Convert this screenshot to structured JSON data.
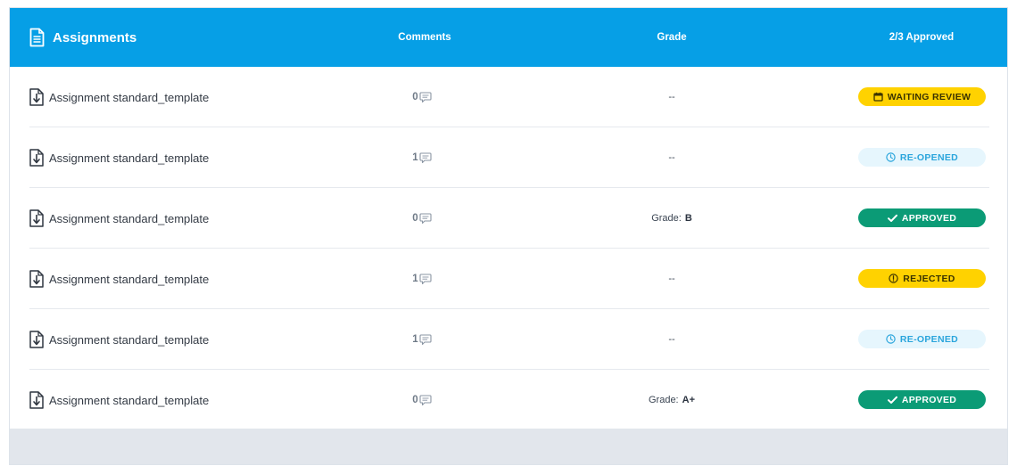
{
  "header": {
    "title": "Assignments",
    "col_comments": "Comments",
    "col_grade": "Grade",
    "col_approved": "2/3 Approved"
  },
  "rows": [
    {
      "name": "Assignment standard_template",
      "comments": "0",
      "grade_label": "",
      "grade_value": "--",
      "status": "WAITING REVIEW",
      "status_type": "waiting",
      "status_icon": "calendar-icon"
    },
    {
      "name": "Assignment standard_template",
      "comments": "1",
      "grade_label": "",
      "grade_value": "--",
      "status": "RE-OPENED",
      "status_type": "reopened",
      "status_icon": "clock-icon"
    },
    {
      "name": "Assignment standard_template",
      "comments": "0",
      "grade_label": "Grade:",
      "grade_value": "B",
      "status": "APPROVED",
      "status_type": "approved",
      "status_icon": "check-icon"
    },
    {
      "name": "Assignment standard_template",
      "comments": "1",
      "grade_label": "",
      "grade_value": "--",
      "status": "REJECTED",
      "status_type": "rejected",
      "status_icon": "alert-circle-icon"
    },
    {
      "name": "Assignment standard_template",
      "comments": "1",
      "grade_label": "",
      "grade_value": "--",
      "status": "RE-OPENED",
      "status_type": "reopened",
      "status_icon": "clock-icon"
    },
    {
      "name": "Assignment standard_template",
      "comments": "0",
      "grade_label": "Grade:",
      "grade_value": "A+",
      "status": "APPROVED",
      "status_type": "approved",
      "status_icon": "check-icon"
    }
  ],
  "colors": {
    "header_bg": "#069fe6",
    "waiting": "#ffd200",
    "reopened_bg": "#e6f6fd",
    "reopened_text": "#2aa5dc",
    "approved": "#0b9b76",
    "rejected": "#ffd200"
  }
}
